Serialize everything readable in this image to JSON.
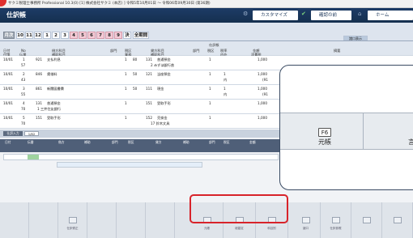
{
  "titlebar": {
    "text": "サクミ税理士事務所 Professional 10.3(0)  [1] 株式会社サクミ (本店) ] 令和5年10月01日 ～ 令和06年09月30日 (第36期)"
  },
  "app": {
    "title": "仕訳帳"
  },
  "header": {
    "customize_label": "カスタマイズ",
    "confirm_label": "確認の前",
    "home_label": "ホーム"
  },
  "months": {
    "label": "月次",
    "items": [
      "10",
      "11",
      "12",
      "1",
      "2",
      "3",
      "4",
      "5",
      "6",
      "7",
      "8",
      "9",
      "決",
      "全期間"
    ],
    "pink": [
      5,
      6,
      7,
      8,
      9
    ]
  },
  "filter_label": "諸口表示",
  "grid": {
    "headers": {
      "date": "日付",
      "no": "No",
      "debit_account": "借方科目",
      "dept": "部門",
      "tax": "税区",
      "credit_account": "貸方科目",
      "credit_dept": "部門",
      "credit_tax": "税区",
      "rate": "税率",
      "amount": "金額",
      "memo": "摘要"
    },
    "subheaders": {
      "type": "付箋",
      "voucher": "伝番",
      "counter": "補助科目",
      "sub": "業務",
      "inner": "内外",
      "tax_amount": "消費税",
      "credit_sub": "補助科目"
    },
    "top_label": "仕訳帳",
    "rows": [
      {
        "date": "10/01",
        "no": "1",
        "v": "57",
        "dcode": "921",
        "dname": "支払利息",
        "tax": "1",
        "tcode": "80",
        "ccode": "131",
        "cname": "普通預金",
        "csub": "2 みずほ銀行普",
        "rate": "1",
        "amount": "1,000",
        "inner": "",
        "tax_amt": ""
      },
      {
        "date": "10/01",
        "no": "2",
        "v": "43",
        "dcode": "846",
        "dname": "賃借料",
        "tax": "1",
        "tcode": "50",
        "ccode": "121",
        "cname": "当座預金",
        "csub": "",
        "rate": "1",
        "amount": "1,000",
        "inner": "内",
        "tax_amt": "(91"
      },
      {
        "date": "10/01",
        "no": "3",
        "v": "55",
        "dcode": "861",
        "dname": "新聞図書費",
        "tax": "1",
        "tcode": "50",
        "ccode": "111",
        "cname": "現金",
        "csub": "",
        "rate": "1",
        "amount": "1,000",
        "inner": "内",
        "tax_amt": "(91"
      },
      {
        "date": "10/01",
        "no": "4",
        "v": "70",
        "dcode": "131",
        "dname": "普通預金",
        "dsub": "1 三井住友銀行",
        "tax": "",
        "tcode": "",
        "ccode": "151",
        "cname": "受取手形",
        "csub": "",
        "rate": "1",
        "amount": "1,000",
        "inner": "",
        "tax_amt": ""
      },
      {
        "date": "10/01",
        "no": "5",
        "v": "70",
        "dcode": "151",
        "dname": "受取手形",
        "tax": "1",
        "tcode": "",
        "ccode": "152",
        "cname": "売掛金",
        "csub": "17 鈴木文具",
        "rate": "1",
        "amount": "1,000",
        "inner": "",
        "tax_amt": ""
      }
    ]
  },
  "lower": {
    "label": "仕訳入力",
    "count": "1/62",
    "headers": [
      "日付",
      "伝番",
      "借方",
      "補助",
      "部門",
      "税区",
      "貸方",
      "補助",
      "部門",
      "税区",
      "金額",
      "摘要"
    ]
  },
  "fkeys": [
    "",
    "",
    "仕訳修正",
    "",
    "",
    "",
    "元帳",
    "総勘定",
    "科目別",
    "諸口",
    "仕訳参照",
    "",
    "",
    ""
  ],
  "popup": {
    "key": "F6",
    "label": "元帳",
    "partial": "言"
  },
  "colors": {
    "appbar": "#1d3b66",
    "highlight": "#d8232a",
    "pink": "#f4cbd6"
  }
}
